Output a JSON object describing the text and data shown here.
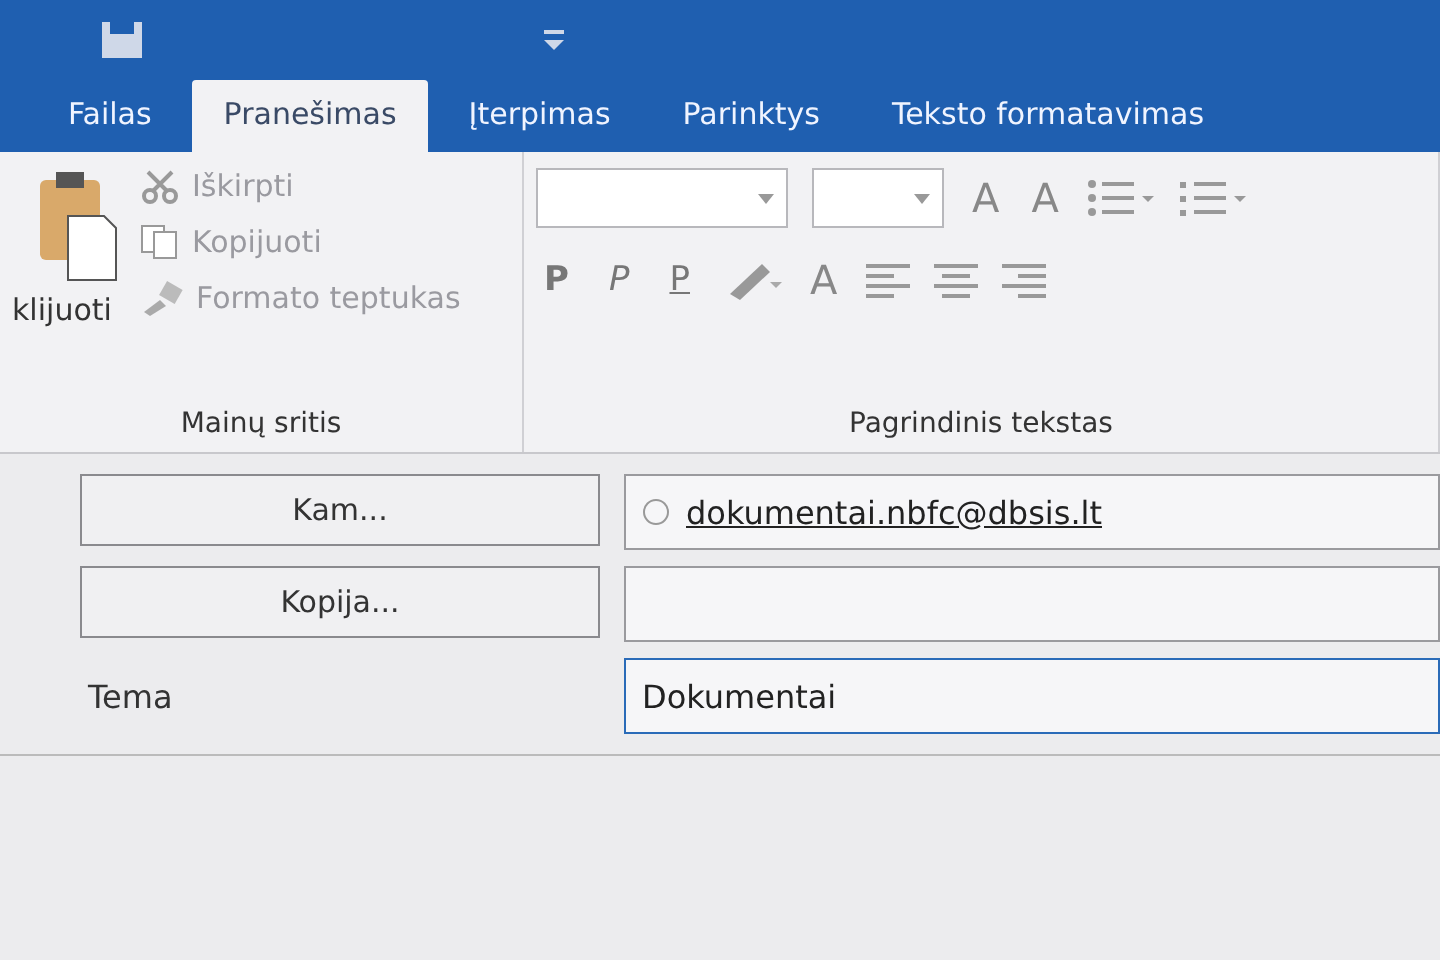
{
  "tabs": [
    {
      "label": "Failas",
      "selected": false
    },
    {
      "label": "Pranešimas",
      "selected": true
    },
    {
      "label": "Įterpimas",
      "selected": false
    },
    {
      "label": "Parinktys",
      "selected": false
    },
    {
      "label": "Teksto formatavimas",
      "selected": false
    }
  ],
  "clipboard": {
    "paste_label": "klijuoti",
    "items": [
      {
        "kind": "cut",
        "label": "Iškirpti",
        "disabled": true
      },
      {
        "kind": "copy",
        "label": "Kopijuoti",
        "disabled": true
      },
      {
        "kind": "painter",
        "label": "Formato teptukas",
        "disabled": true
      }
    ],
    "group_label": "Mainų sritis"
  },
  "basic_text": {
    "format_buttons": [
      {
        "kind": "bold",
        "label": "P"
      },
      {
        "kind": "italic",
        "label": "P"
      },
      {
        "kind": "underline",
        "label": "P"
      }
    ],
    "color_label": "A",
    "grow_labels": [
      "A",
      "A"
    ],
    "group_label": "Pagrindinis tekstas"
  },
  "header": {
    "to_button": "Kam...",
    "cc_button": "Kopija...",
    "subject_label": "Tema",
    "recipient": "dokumentai.nbfc@dbsis.lt",
    "subject": "Dokumentai"
  }
}
